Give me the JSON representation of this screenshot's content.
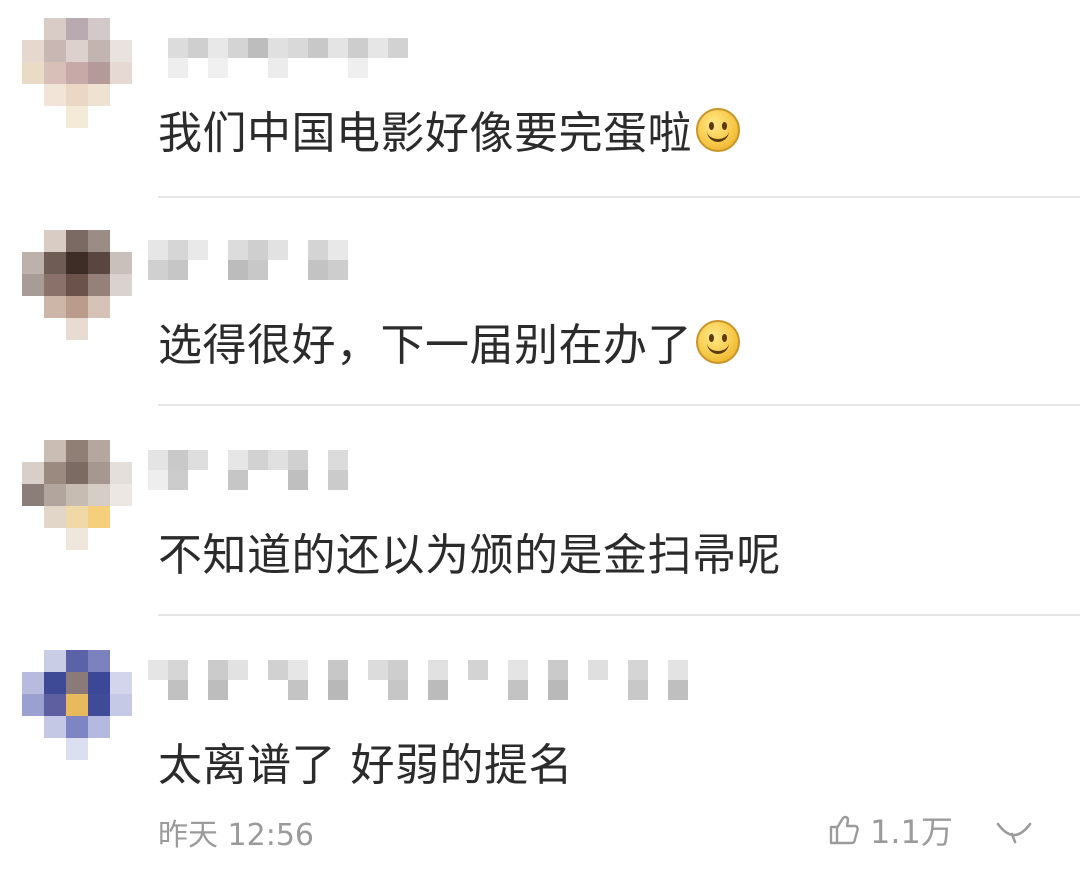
{
  "comments": [
    {
      "text": "我们中国电影好像要完蛋啦",
      "emoji": "smile-icon"
    },
    {
      "text": "选得很好，下一届别在办了",
      "emoji": "smile-icon"
    },
    {
      "text": "不知道的还以为颁的是金扫帚呢",
      "emoji": null
    },
    {
      "text": "太离谱了 好弱的提名",
      "emoji": null
    }
  ],
  "footer": {
    "timestamp": "昨天 12:56",
    "like_count": "1.1万",
    "like_icon": "thumbs-up-icon",
    "reply_icon": "comment-icon"
  },
  "colors": {
    "text": "#2b2b2b",
    "meta": "#9b9b9b",
    "divider": "#e6e6e6"
  }
}
